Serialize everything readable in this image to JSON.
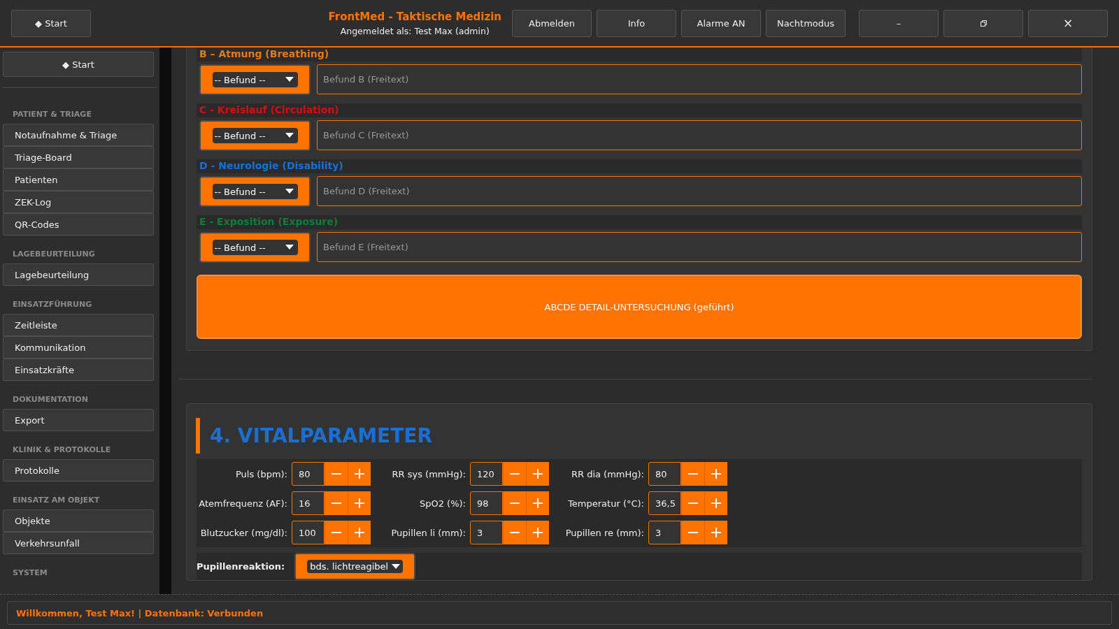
{
  "topbar": {
    "start_button": "◆ Start",
    "title": "FrontMed - Taktische Medizin",
    "subtitle": "Angemeldet als: Test Max (admin)",
    "buttons": [
      "Abmelden",
      "Info",
      "Alarme AN",
      "Nachtmodus"
    ],
    "window_controls": [
      {
        "kind": "minimize",
        "label": "–"
      },
      {
        "kind": "restore"
      },
      {
        "kind": "close",
        "label": "×"
      }
    ]
  },
  "sidebar": {
    "start_button": "◆ Start",
    "groups": [
      {
        "title": "PATIENT & TRIAGE",
        "items": [
          "Notaufnahme & Triage",
          "Triage-Board",
          "Patienten",
          "ZEK-Log",
          "QR-Codes"
        ]
      },
      {
        "title": "LAGEBEURTEILUNG",
        "items": [
          "Lagebeurteilung"
        ]
      },
      {
        "title": "EINSATZFÜHRUNG",
        "items": [
          "Zeitleiste",
          "Kommunikation",
          "Einsatzkräfte"
        ]
      },
      {
        "title": "DOKUMENTATION",
        "items": [
          "Export"
        ]
      },
      {
        "title": "KLINIK & PROTOKOLLE",
        "items": [
          "Protokolle"
        ]
      },
      {
        "title": "EINSATZ AM OBJEKT",
        "items": [
          "Objekte",
          "Verkehrsunfall"
        ]
      },
      {
        "title": "SYSTEM"
      }
    ]
  },
  "abcde": {
    "sections": [
      {
        "title": "B – Atmung (Breathing)",
        "color": "#e07b1a",
        "select": "-- Befund --",
        "placeholder": "Befund B (Freitext)"
      },
      {
        "title": "C - Kreislauf (Circulation)",
        "color": "#d01010",
        "select": "-- Befund --",
        "placeholder": "Befund C (Freitext)"
      },
      {
        "title": "D - Neurologie (Disability)",
        "color": "#1a6fd1",
        "select": "-- Befund --",
        "placeholder": "Befund D (Freitext)"
      },
      {
        "title": "E - Exposition (Exposure)",
        "color": "#127a3a",
        "select": "-- Befund --",
        "placeholder": "Befund E (Freitext)"
      }
    ],
    "detail_button": "ABCDE DETAIL-UNTERSUCHUNG (geführt)"
  },
  "vitals": {
    "title": "4. VITALPARAMETER",
    "fields": [
      {
        "label": "Puls (bpm):",
        "value": "80"
      },
      {
        "label": "RR sys (mmHg):",
        "value": "120"
      },
      {
        "label": "RR dia (mmHg):",
        "value": "80"
      },
      {
        "label": "Atemfrequenz (AF):",
        "value": "16"
      },
      {
        "label": "SpO2 (%):",
        "value": "98"
      },
      {
        "label": "Temperatur (°C):",
        "value": "36,5"
      },
      {
        "label": "Blutzucker (mg/dl):",
        "value": "100"
      },
      {
        "label": "Pupillen li (mm):",
        "value": "3"
      },
      {
        "label": "Pupillen re (mm):",
        "value": "3"
      }
    ],
    "pupil_reaction": {
      "label": "Pupillenreaktion:",
      "value": "bds. lichtreagibel"
    }
  },
  "status_bar": "Willkommen, Test Max! | Datenbank: Verbunden"
}
